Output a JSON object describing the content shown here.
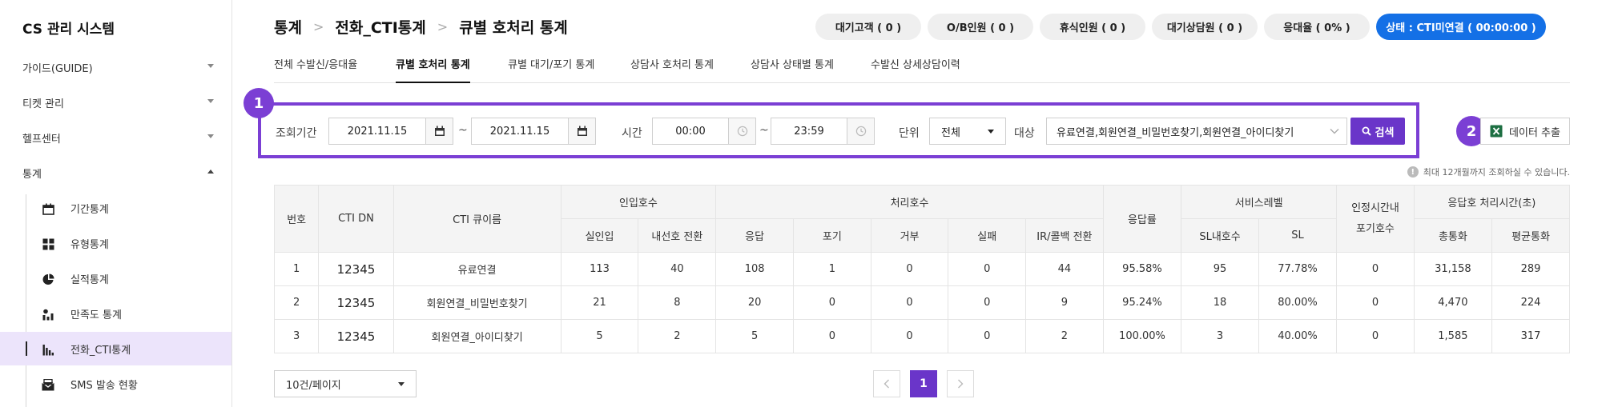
{
  "app": {
    "title": "CS 관리 시스템"
  },
  "sidebar": {
    "menus": [
      {
        "label": "가이드(GUIDE)",
        "expanded": false
      },
      {
        "label": "티켓 관리",
        "expanded": false
      },
      {
        "label": "헬프센터",
        "expanded": false
      },
      {
        "label": "통계",
        "expanded": true
      }
    ],
    "subitems": [
      {
        "label": "기간통계",
        "icon": "calendar-icon"
      },
      {
        "label": "유형통계",
        "icon": "grid-icon"
      },
      {
        "label": "실적통계",
        "icon": "pie-icon"
      },
      {
        "label": "만족도 통계",
        "icon": "satisfaction-icon"
      },
      {
        "label": "전화_CTI통계",
        "icon": "bar-chart-icon",
        "active": true
      },
      {
        "label": "SMS 발송 현황",
        "icon": "mail-icon"
      }
    ]
  },
  "breadcrumb": [
    "통계",
    "전화_CTI통계",
    "큐별 호처리 통계"
  ],
  "status": {
    "pills": [
      "대기고객 ( 0 )",
      "O/B인원 ( 0 )",
      "휴식인원 ( 0 )",
      "대기상담원 ( 0 )",
      "응대율 ( 0% )"
    ],
    "connection": "상태 : CTI미연결 ( 00:00:00 )"
  },
  "tabs": [
    "전체 수발신/응대율",
    "큐별 호처리 통계",
    "큐별 대기/포기 통계",
    "상담사 호처리 통계",
    "상담사 상태별 통계",
    "수발신 상세상담이력"
  ],
  "filter": {
    "badge": "1",
    "period_label": "조회기간",
    "date_from": "2021.11.15",
    "date_to": "2021.11.15",
    "tilde": "~",
    "time_label": "시간",
    "time_from": "00:00",
    "time_to": "23:59",
    "unit_label": "단위",
    "unit_value": "전체",
    "target_label": "대상",
    "target_value": "유료연결,회원연결_비밀번호찾기,회원연결_아이디찾기",
    "search_label": "검색"
  },
  "export": {
    "badge": "2",
    "label": "데이터 추출"
  },
  "notice": "최대 12개월까지 조회하실 수 있습니다.",
  "table": {
    "headers": {
      "no": "번호",
      "dn": "CTI DN",
      "queue": "CTI 큐이름",
      "inbound": "인입호수",
      "inbound_sub": [
        "실인입",
        "내선호 전환"
      ],
      "handled": "처리호수",
      "handled_sub": [
        "응답",
        "포기",
        "거부",
        "실패",
        "IR/콜백 전환"
      ],
      "answer_rate": "응답률",
      "service_level": "서비스레벨",
      "service_level_sub": [
        "SL내호수",
        "SL"
      ],
      "abandon_in_time": "인정시간내\n포기호수",
      "handle_time": "응답호 처리시간(초)",
      "handle_time_sub": [
        "총통화",
        "평균통화"
      ]
    },
    "rows": [
      [
        "1",
        "12345",
        "유료연결",
        "113",
        "40",
        "108",
        "1",
        "0",
        "0",
        "44",
        "95.58%",
        "95",
        "77.78%",
        "0",
        "31,158",
        "289"
      ],
      [
        "2",
        "12345",
        "회원연결_비밀번호찾기",
        "21",
        "8",
        "20",
        "0",
        "0",
        "0",
        "9",
        "95.24%",
        "18",
        "80.00%",
        "0",
        "4,470",
        "224"
      ],
      [
        "3",
        "12345",
        "회원연결_아이디찾기",
        "5",
        "2",
        "5",
        "0",
        "0",
        "0",
        "2",
        "100.00%",
        "3",
        "40.00%",
        "0",
        "1,585",
        "317"
      ]
    ]
  },
  "pagination": {
    "page_size": "10건/페이지",
    "current": "1"
  },
  "colors": {
    "accent": "#7b3fd4",
    "primary_button": "#6a35c9",
    "status_blue": "#1470e6"
  }
}
